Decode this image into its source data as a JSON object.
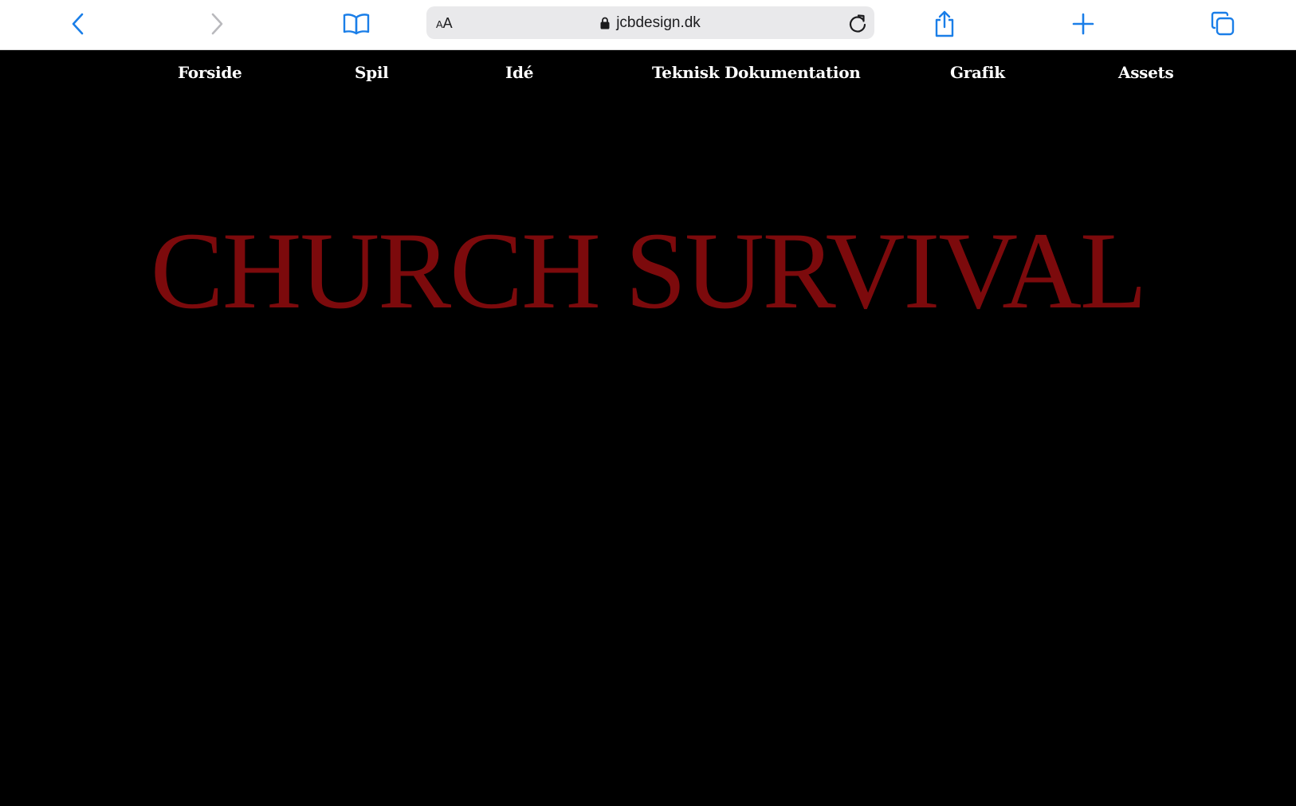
{
  "browser": {
    "address_bar": {
      "text_size_button": {
        "small": "A",
        "big": "A"
      },
      "url": "jcbdesign.dk"
    },
    "accent_color": "#1a7ee8",
    "icons": {
      "back": "chevron-left-icon",
      "forward": "chevron-right-icon",
      "bookmarks": "open-book-icon",
      "lock": "lock-icon",
      "reload": "reload-icon",
      "share": "share-icon",
      "new_tab": "plus-icon",
      "tabs": "tabs-overview-icon"
    }
  },
  "site": {
    "nav": [
      {
        "label": "Forside"
      },
      {
        "label": "Spil"
      },
      {
        "label": "Idé"
      },
      {
        "label": "Teknisk Dokumentation"
      },
      {
        "label": "Grafik"
      },
      {
        "label": "Assets"
      }
    ],
    "hero_title": "CHURCH SURVIVAL",
    "hero_color": "#7c0a0c",
    "background_color": "#000000"
  }
}
